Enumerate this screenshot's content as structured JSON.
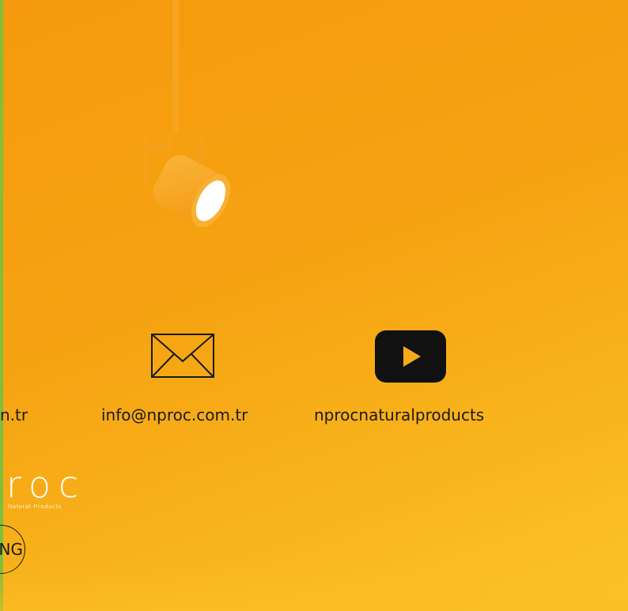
{
  "contact": {
    "email_partial": "n.tr",
    "email": "info@nproc.com.tr",
    "youtube": "nprocnaturalproducts"
  },
  "icons": {
    "email": "mail-envelope-icon",
    "youtube": "youtube-play-icon",
    "lamp": "spotlight-lamp-image"
  },
  "logo": {
    "text": "roc",
    "subtitle": "Natural Products"
  },
  "language_button": {
    "label": "NG"
  },
  "colors": {
    "background_top": "#f59a0e",
    "background_bottom": "#fbc427",
    "accent_stripe": "#7fbf3a",
    "text": "#1a1a1a",
    "youtube_icon": "#111111"
  }
}
